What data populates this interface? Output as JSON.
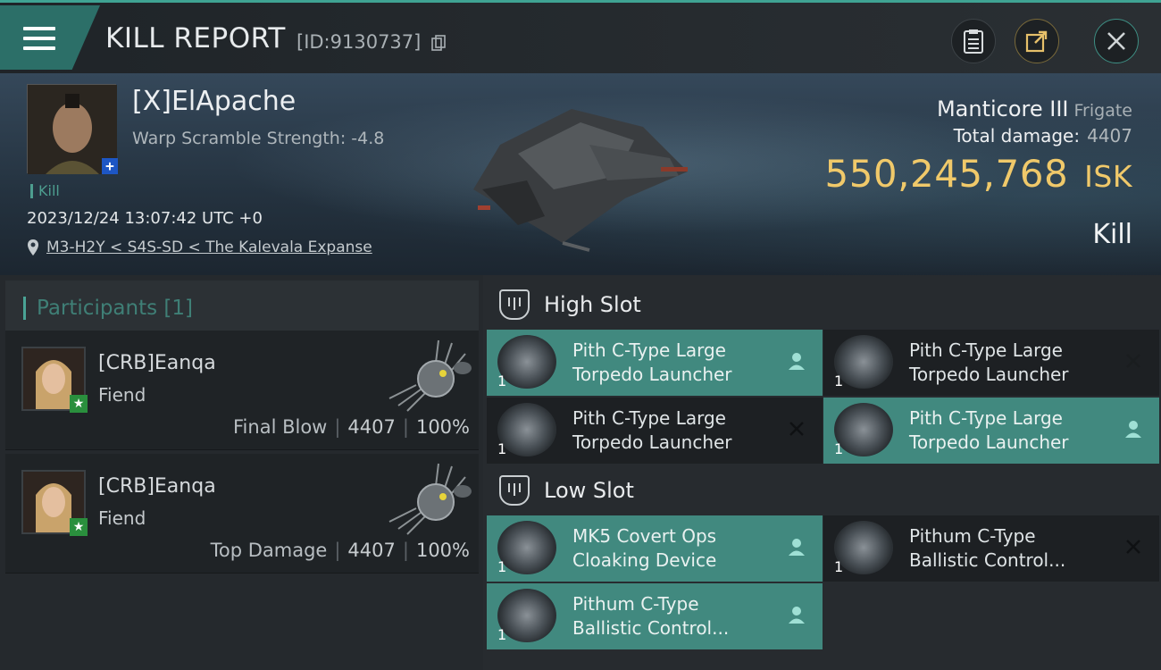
{
  "header": {
    "title": "KILL REPORT",
    "report_id": "[ID:9130737]"
  },
  "victim": {
    "name": "[X]ElApache",
    "warp_scramble": "Warp Scramble Strength: -4.8",
    "kill_tag": "Kill",
    "datetime": "2023/12/24 13:07:42 UTC +0",
    "location": "M3-H2Y < S4S-SD < The Kalevala Expanse",
    "ship_name": "Manticore III",
    "ship_class": "Frigate",
    "total_damage_label": "Total damage:",
    "total_damage_value": "4407",
    "isk_value": "550,245,768",
    "isk_unit": "ISK",
    "result": "Kill"
  },
  "participants": {
    "title": "Participants [1]",
    "rows": [
      {
        "name": "[CRB]Eanqa",
        "ship": "Fiend",
        "label": "Final Blow",
        "damage": "4407",
        "percent": "100%"
      },
      {
        "name": "[CRB]Eanqa",
        "ship": "Fiend",
        "label": "Top Damage",
        "damage": "4407",
        "percent": "100%"
      }
    ]
  },
  "fittings": {
    "high_slot_title": "High Slot",
    "low_slot_title": "Low Slot",
    "high": [
      {
        "line1": "Pith C-Type Large",
        "line2": "Torpedo Launcher",
        "qty": "1",
        "status": "dropped"
      },
      {
        "line1": "Pith C-Type Large",
        "line2": "Torpedo Launcher",
        "qty": "1",
        "status": "destroyed"
      },
      {
        "line1": "Pith C-Type Large",
        "line2": "Torpedo Launcher",
        "qty": "1",
        "status": "destroyed"
      },
      {
        "line1": "Pith C-Type Large",
        "line2": "Torpedo Launcher",
        "qty": "1",
        "status": "dropped"
      }
    ],
    "low": [
      {
        "line1": "MK5 Covert Ops",
        "line2": "Cloaking Device",
        "qty": "1",
        "status": "dropped"
      },
      {
        "line1": "Pithum C-Type",
        "line2": "Ballistic Control...",
        "qty": "1",
        "status": "destroyed"
      },
      {
        "line1": "Pithum C-Type",
        "line2": "Ballistic Control...",
        "qty": "1",
        "status": "dropped"
      }
    ]
  },
  "colors": {
    "accent": "#41897f",
    "isk": "#f0c96a",
    "badge_blue": "#1d56c4",
    "badge_green": "#2a8f3d"
  }
}
